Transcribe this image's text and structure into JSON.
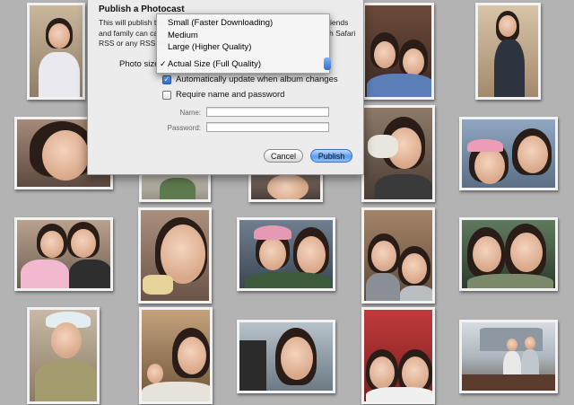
{
  "dialog": {
    "title": "Publish a Photocast",
    "description_lines": [
      "This will publish the",
      "and family can ca",
      "RSS or any RSS rea"
    ],
    "description_tail": [
      "iends",
      "h Safari"
    ],
    "photo_size_label": "Photo size",
    "auto_update_label": "Automatically update when album changes",
    "auto_update_checked": true,
    "require_password_label": "Require name and password",
    "require_password_checked": false,
    "name_label": "Name:",
    "name_value": "",
    "password_label": "Password:",
    "password_value": "",
    "cancel_label": "Cancel",
    "publish_label": "Publish"
  },
  "photo_size_menu": {
    "options": [
      "Small (Faster Downloading)",
      "Medium",
      "Large (Higher Quality)",
      "Actual Size (Full Quality)"
    ],
    "selected": "Actual Size (Full Quality)",
    "check_glyph": "✓"
  },
  "colors": {
    "background": "#b3b3b3",
    "dialog_bg": "#ececec",
    "selection_blue": "#3a7be0",
    "photo_border": "#f2f2f2"
  },
  "photos": [
    "photo-1",
    "photo-2",
    "photo-3",
    "photo-4",
    "photo-5",
    "photo-6",
    "photo-7",
    "photo-8",
    "photo-9",
    "photo-10",
    "photo-11",
    "photo-12",
    "photo-13",
    "photo-14",
    "photo-15",
    "photo-16",
    "photo-17",
    "photo-18",
    "photo-19",
    "photo-20",
    "photo-21"
  ]
}
